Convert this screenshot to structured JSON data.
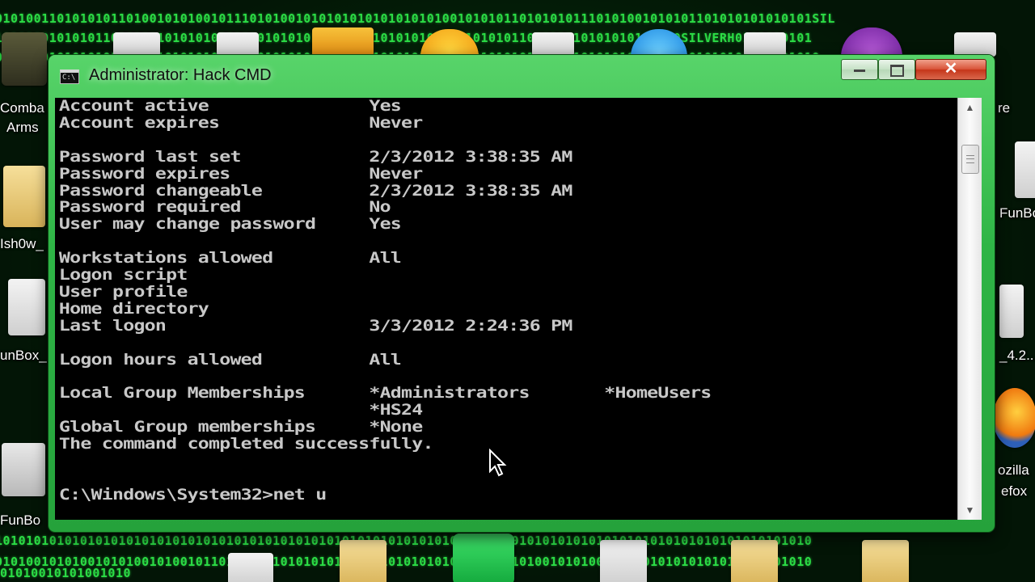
{
  "desktop": {
    "binary_rows": [
      "0101001101010101101001010100101110101001010101010101010101001010101101010101110101001010101101010101010101SIL",
      "10101001010101101010010101010101010101010101001011010101010101010101101011110101010101010SILVERH0101010101",
      "01010101010101010101010101010101010101010101010101010101010101010101010101010101010101010101010101010101010",
      "1010101010101010101010101010101010101010101010101010101010101010101010101010101010101010101010101010101010",
      "0101001010100101010010100101101010101010101010010110101010101010110101001010100101010101010101010100101010"
    ],
    "bottom_binary": "01010010101001010",
    "icon_labels": {
      "combat_arms_line1": "Comba",
      "combat_arms_line2": "Arms",
      "hsh0w": "Ish0w_",
      "funbox_left": "unBox_",
      "funbox_left2": "FunBo",
      "funbox_right": "FunBo",
      "version": "_4.2...",
      "firefox_1": "ozilla",
      "firefox_2": "efox",
      "re": "re"
    }
  },
  "window": {
    "title": "Administrator: Hack CMD",
    "icon_text": "C:\\",
    "minimize_symbol": "—",
    "maximize_symbol": "□",
    "close_symbol": "✕"
  },
  "console": {
    "text": "Account active               Yes\nAccount expires              Never\n\nPassword last set            2/3/2012 3:38:35 AM\nPassword expires             Never\nPassword changeable          2/3/2012 3:38:35 AM\nPassword required            No\nUser may change password     Yes\n\nWorkstations allowed         All\nLogon script\nUser profile\nHome directory\nLast logon                   3/3/2012 2:24:36 PM\n\nLogon hours allowed          All\n\nLocal Group Memberships      *Administrators       *HomeUsers\n                             *HS24\nGlobal Group memberships     *None\nThe command completed successfully.\n\n\nC:\\Windows\\System32>net u"
  },
  "scrollbar": {
    "up_arrow": "▲",
    "down_arrow": "▼"
  }
}
